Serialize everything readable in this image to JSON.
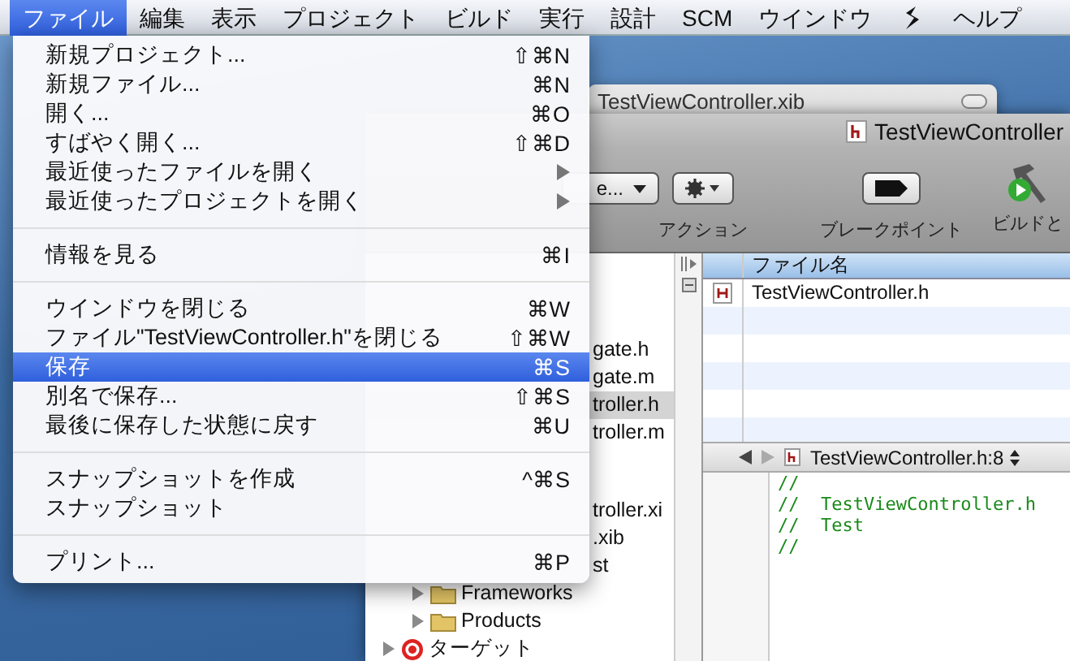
{
  "menubar": {
    "items": [
      {
        "kind": "label",
        "label": "ファイル",
        "selected": true
      },
      {
        "kind": "label",
        "label": "編集",
        "selected": false
      },
      {
        "kind": "label",
        "label": "表示",
        "selected": false
      },
      {
        "kind": "label",
        "label": "プロジェクト",
        "selected": false
      },
      {
        "kind": "label",
        "label": "ビルド",
        "selected": false
      },
      {
        "kind": "label",
        "label": "実行",
        "selected": false
      },
      {
        "kind": "label",
        "label": "設計",
        "selected": false
      },
      {
        "kind": "label",
        "label": "SCM",
        "selected": false
      },
      {
        "kind": "label",
        "label": "ウインドウ",
        "selected": false
      },
      {
        "kind": "icon",
        "selected": false
      },
      {
        "kind": "label",
        "label": "ヘルプ",
        "selected": false
      }
    ]
  },
  "file_menu": {
    "items": [
      {
        "kind": "item",
        "label": "新規プロジェクト...",
        "shortcut": "⇧⌘N",
        "selected": false
      },
      {
        "kind": "item",
        "label": "新規ファイル...",
        "shortcut": "⌘N",
        "selected": false
      },
      {
        "kind": "item",
        "label": "開く...",
        "shortcut": "⌘O",
        "selected": false
      },
      {
        "kind": "item",
        "label": "すばやく開く...",
        "shortcut": "⇧⌘D",
        "selected": false
      },
      {
        "kind": "submenu",
        "label": "最近使ったファイルを開く",
        "selected": false
      },
      {
        "kind": "submenu",
        "label": "最近使ったプロジェクトを開く",
        "selected": false
      },
      {
        "kind": "separator"
      },
      {
        "kind": "item",
        "label": "情報を見る",
        "shortcut": "⌘I",
        "selected": false
      },
      {
        "kind": "separator"
      },
      {
        "kind": "item",
        "label": "ウインドウを閉じる",
        "shortcut": "⌘W",
        "selected": false
      },
      {
        "kind": "item",
        "label": "ファイル\"TestViewController.h\"を閉じる",
        "shortcut": "⇧⌘W",
        "selected": false
      },
      {
        "kind": "item",
        "label": "保存",
        "shortcut": "⌘S",
        "selected": true
      },
      {
        "kind": "item",
        "label": "別名で保存...",
        "shortcut": "⇧⌘S",
        "selected": false
      },
      {
        "kind": "item",
        "label": "最後に保存した状態に戻す",
        "shortcut": "⌘U",
        "selected": false
      },
      {
        "kind": "separator"
      },
      {
        "kind": "item",
        "label": "スナップショットを作成",
        "shortcut": "^⌘S",
        "selected": false
      },
      {
        "kind": "item",
        "label": "スナップショット",
        "selected": false
      },
      {
        "kind": "separator"
      },
      {
        "kind": "item",
        "label": "プリント...",
        "shortcut": "⌘P",
        "selected": false
      }
    ]
  },
  "xib_window": {
    "title": "TestViewController.xib"
  },
  "project_window": {
    "title": "TestViewController",
    "toolbar": [
      {
        "kind": "popup",
        "value": "e..."
      },
      {
        "kind": "action",
        "label": "アクション"
      },
      {
        "kind": "breakpoint",
        "label": "ブレークポイント"
      },
      {
        "kind": "build",
        "label": "ビルドと"
      }
    ],
    "sidebar": {
      "files": [
        {
          "label": "gate.h",
          "selected": false
        },
        {
          "label": "gate.m",
          "selected": false
        },
        {
          "label": "troller.h",
          "selected": true
        },
        {
          "label": "troller.m",
          "selected": false
        }
      ],
      "resources": [
        {
          "label": "troller.xi",
          "selected": false
        },
        {
          "label": ".xib",
          "selected": false
        },
        {
          "label": "st",
          "selected": false
        }
      ],
      "groups": [
        {
          "kind": "folder",
          "label": "Frameworks",
          "expanded": false
        },
        {
          "kind": "folder",
          "label": "Products",
          "expanded": false
        },
        {
          "kind": "target",
          "label": "ターゲット",
          "expanded": false
        }
      ]
    },
    "file_list": {
      "column": "ファイル名",
      "rows": [
        {
          "name": "TestViewController.h"
        }
      ]
    },
    "editor": {
      "location": "TestViewController.h:8",
      "lines": [
        "//",
        "//  TestViewController.h",
        "//  Test",
        "//"
      ]
    }
  }
}
